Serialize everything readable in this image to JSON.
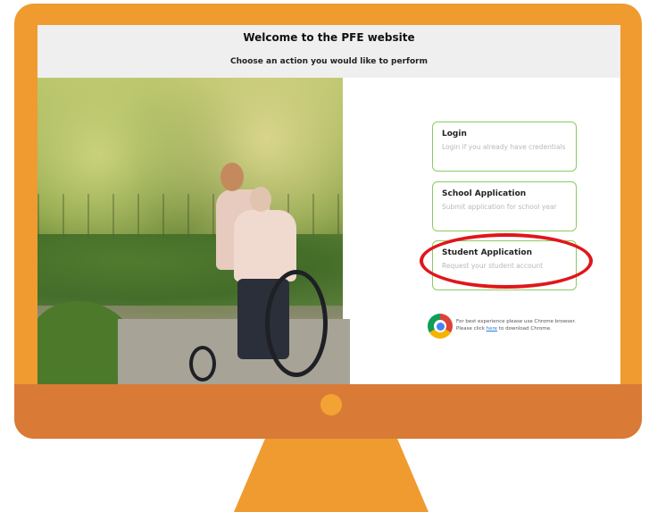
{
  "header": {
    "title": "Welcome to the PFE website",
    "subtitle": "Choose an action you would like to perform"
  },
  "options": [
    {
      "title": "Login",
      "description": "Login if you already have credentials"
    },
    {
      "title": "School Application",
      "description": "Submit application for school year"
    },
    {
      "title": "Student Application",
      "description": "Request your student account"
    }
  ],
  "chrome_notice": {
    "line1": "For best experience please use Chrome browser.",
    "line2_prefix": "Please click ",
    "link": "here",
    "line2_suffix": " to download Chrome."
  },
  "colors": {
    "frame": "#EF9B30",
    "chin": "#D97A37",
    "card_border": "#8BCB62",
    "highlight": "#E0161B"
  },
  "icons": {
    "browser": "chrome-icon"
  }
}
